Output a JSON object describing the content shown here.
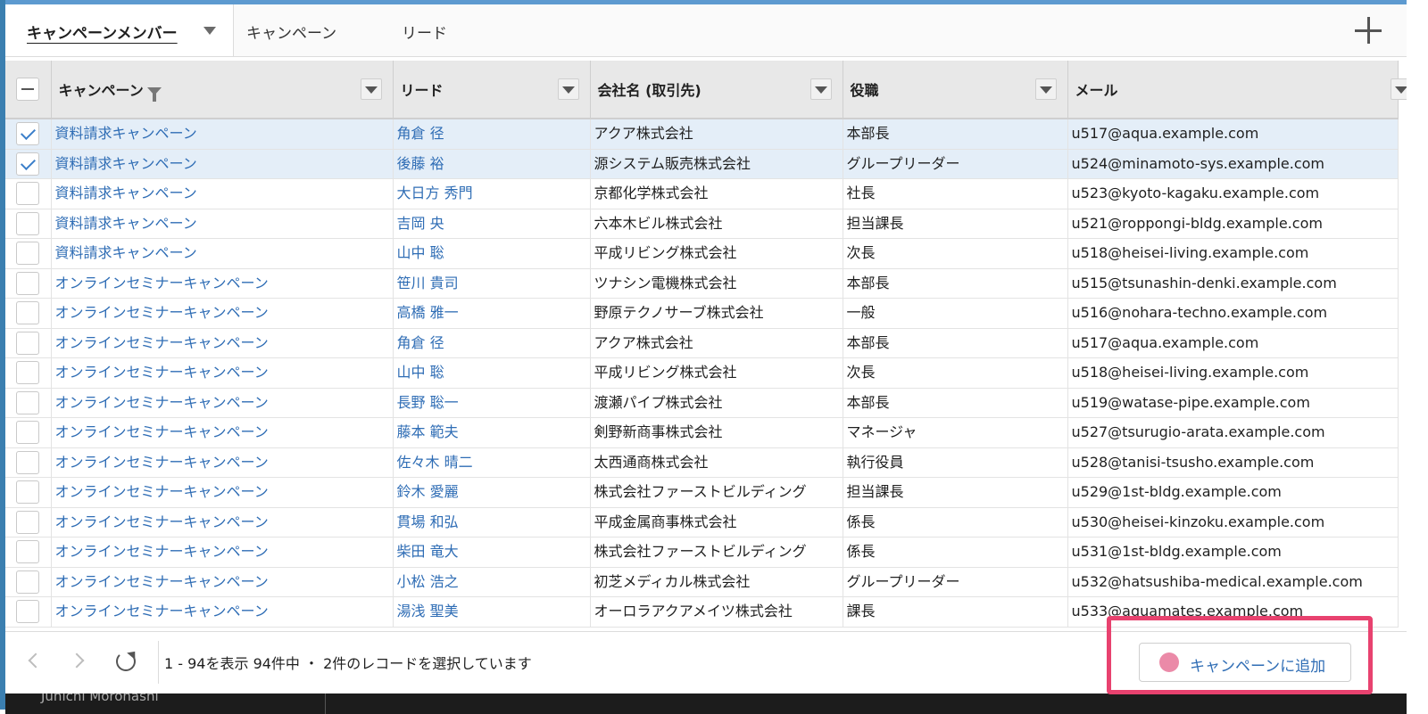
{
  "tabs": {
    "active": "キャンペーンメンバー",
    "items": [
      "キャンペーン",
      "リード"
    ]
  },
  "table": {
    "columns": [
      "キャンペーン",
      "リード",
      "会社名 (取引先)",
      "役職",
      "メール"
    ],
    "rows": [
      {
        "campaign": "資料請求キャンペーン",
        "lead": "角倉 径",
        "company": "アクア株式会社",
        "title": "本部長",
        "email": "u517@aqua.example.com",
        "selected": true
      },
      {
        "campaign": "資料請求キャンペーン",
        "lead": "後藤 裕",
        "company": "源システム販売株式会社",
        "title": "グループリーダー",
        "email": "u524@minamoto-sys.example.com",
        "selected": true
      },
      {
        "campaign": "資料請求キャンペーン",
        "lead": "大日方 秀門",
        "company": "京都化学株式会社",
        "title": "社長",
        "email": "u523@kyoto-kagaku.example.com",
        "selected": false
      },
      {
        "campaign": "資料請求キャンペーン",
        "lead": "吉岡 央",
        "company": "六本木ビル株式会社",
        "title": "担当課長",
        "email": "u521@roppongi-bldg.example.com",
        "selected": false
      },
      {
        "campaign": "資料請求キャンペーン",
        "lead": "山中 聡",
        "company": "平成リビング株式会社",
        "title": "次長",
        "email": "u518@heisei-living.example.com",
        "selected": false
      },
      {
        "campaign": "オンラインセミナーキャンペーン",
        "lead": "笹川 貴司",
        "company": "ツナシン電機株式会社",
        "title": "本部長",
        "email": "u515@tsunashin-denki.example.com",
        "selected": false
      },
      {
        "campaign": "オンラインセミナーキャンペーン",
        "lead": "高橋 雅一",
        "company": "野原テクノサーブ株式会社",
        "title": "一般",
        "email": "u516@nohara-techno.example.com",
        "selected": false
      },
      {
        "campaign": "オンラインセミナーキャンペーン",
        "lead": "角倉 径",
        "company": "アクア株式会社",
        "title": "本部長",
        "email": "u517@aqua.example.com",
        "selected": false
      },
      {
        "campaign": "オンラインセミナーキャンペーン",
        "lead": "山中 聡",
        "company": "平成リビング株式会社",
        "title": "次長",
        "email": "u518@heisei-living.example.com",
        "selected": false
      },
      {
        "campaign": "オンラインセミナーキャンペーン",
        "lead": "長野 聡一",
        "company": "渡瀬パイプ株式会社",
        "title": "本部長",
        "email": "u519@watase-pipe.example.com",
        "selected": false
      },
      {
        "campaign": "オンラインセミナーキャンペーン",
        "lead": "藤本 範夫",
        "company": "剣野新商事株式会社",
        "title": "マネージャ",
        "email": "u527@tsurugio-arata.example.com",
        "selected": false
      },
      {
        "campaign": "オンラインセミナーキャンペーン",
        "lead": "佐々木 晴二",
        "company": "太西通商株式会社",
        "title": "執行役員",
        "email": "u528@tanisi-tsusho.example.com",
        "selected": false
      },
      {
        "campaign": "オンラインセミナーキャンペーン",
        "lead": "鈴木 愛麗",
        "company": "株式会社ファーストビルディング",
        "title": "担当課長",
        "email": "u529@1st-bldg.example.com",
        "selected": false
      },
      {
        "campaign": "オンラインセミナーキャンペーン",
        "lead": "貫場 和弘",
        "company": "平成金属商事株式会社",
        "title": "係長",
        "email": "u530@heisei-kinzoku.example.com",
        "selected": false
      },
      {
        "campaign": "オンラインセミナーキャンペーン",
        "lead": "柴田 竜大",
        "company": "株式会社ファーストビルディング",
        "title": "係長",
        "email": "u531@1st-bldg.example.com",
        "selected": false
      },
      {
        "campaign": "オンラインセミナーキャンペーン",
        "lead": "小松 浩之",
        "company": "初芝メディカル株式会社",
        "title": "グループリーダー",
        "email": "u532@hatsushiba-medical.example.com",
        "selected": false
      },
      {
        "campaign": "オンラインセミナーキャンペーン",
        "lead": "湯浅 聖美",
        "company": "オーロラアクアメイツ株式会社",
        "title": "課長",
        "email": "u533@aquamates.example.com",
        "selected": false
      }
    ]
  },
  "footer": {
    "status": "1 - 94を表示 94件中 ・ 2件のレコードを選択しています",
    "add_button": "キャンペーンに追加"
  },
  "background_text": "Junichi Morohashi",
  "colors": {
    "link": "#2f6db5",
    "highlight": "#e8426f",
    "selected_row": "#e4eef8",
    "button_dot": "#eb8aa8"
  }
}
